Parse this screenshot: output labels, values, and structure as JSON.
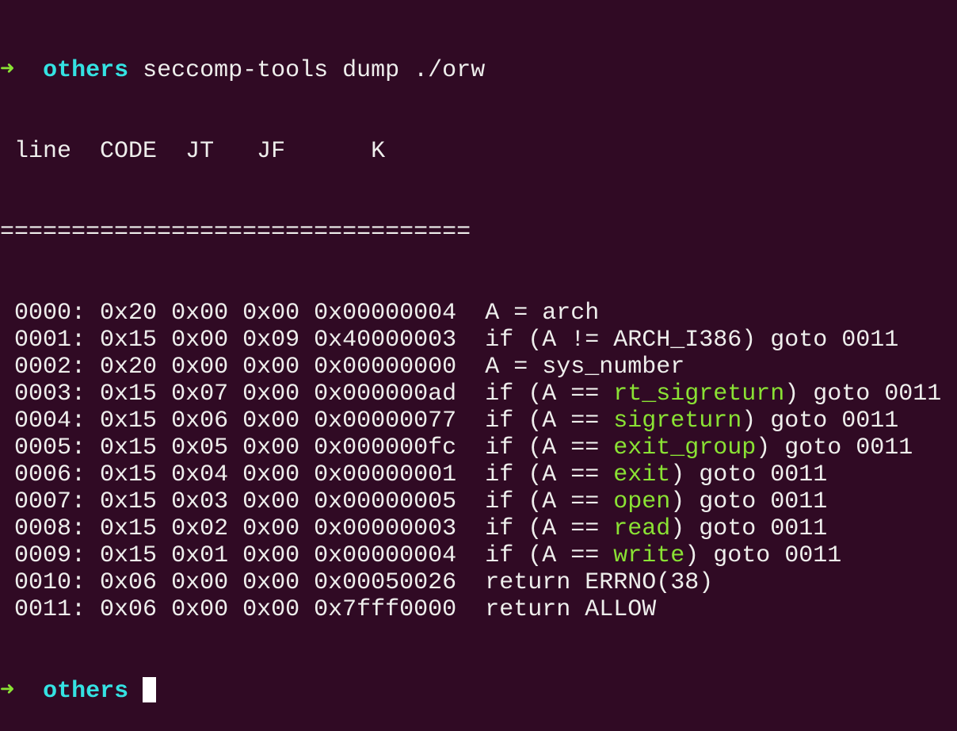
{
  "prompt": {
    "arrow": "➜",
    "dir": "others",
    "command": "seccomp-tools dump ./orw"
  },
  "header": {
    "line": "line",
    "code": "CODE",
    "jt": "JT",
    "jf": "JF",
    "k": "K"
  },
  "separator": "=================================",
  "rows": [
    {
      "line": "0000",
      "code": "0x20",
      "jt": "0x00",
      "jf": "0x00",
      "k": "0x00000004",
      "pre": "A = arch",
      "hl": "",
      "post": ""
    },
    {
      "line": "0001",
      "code": "0x15",
      "jt": "0x00",
      "jf": "0x09",
      "k": "0x40000003",
      "pre": "if (A != ARCH_I386) goto 0011",
      "hl": "",
      "post": ""
    },
    {
      "line": "0002",
      "code": "0x20",
      "jt": "0x00",
      "jf": "0x00",
      "k": "0x00000000",
      "pre": "A = sys_number",
      "hl": "",
      "post": ""
    },
    {
      "line": "0003",
      "code": "0x15",
      "jt": "0x07",
      "jf": "0x00",
      "k": "0x000000ad",
      "pre": "if (A == ",
      "hl": "rt_sigreturn",
      "post": ") goto 0011"
    },
    {
      "line": "0004",
      "code": "0x15",
      "jt": "0x06",
      "jf": "0x00",
      "k": "0x00000077",
      "pre": "if (A == ",
      "hl": "sigreturn",
      "post": ") goto 0011"
    },
    {
      "line": "0005",
      "code": "0x15",
      "jt": "0x05",
      "jf": "0x00",
      "k": "0x000000fc",
      "pre": "if (A == ",
      "hl": "exit_group",
      "post": ") goto 0011"
    },
    {
      "line": "0006",
      "code": "0x15",
      "jt": "0x04",
      "jf": "0x00",
      "k": "0x00000001",
      "pre": "if (A == ",
      "hl": "exit",
      "post": ") goto 0011"
    },
    {
      "line": "0007",
      "code": "0x15",
      "jt": "0x03",
      "jf": "0x00",
      "k": "0x00000005",
      "pre": "if (A == ",
      "hl": "open",
      "post": ") goto 0011"
    },
    {
      "line": "0008",
      "code": "0x15",
      "jt": "0x02",
      "jf": "0x00",
      "k": "0x00000003",
      "pre": "if (A == ",
      "hl": "read",
      "post": ") goto 0011"
    },
    {
      "line": "0009",
      "code": "0x15",
      "jt": "0x01",
      "jf": "0x00",
      "k": "0x00000004",
      "pre": "if (A == ",
      "hl": "write",
      "post": ") goto 0011"
    },
    {
      "line": "0010",
      "code": "0x06",
      "jt": "0x00",
      "jf": "0x00",
      "k": "0x00050026",
      "pre": "return ERRNO(38)",
      "hl": "",
      "post": ""
    },
    {
      "line": "0011",
      "code": "0x06",
      "jt": "0x00",
      "jf": "0x00",
      "k": "0x7fff0000",
      "pre": "return ALLOW",
      "hl": "",
      "post": ""
    }
  ],
  "final_prompt": {
    "arrow": "➜",
    "dir": "others"
  },
  "colors": {
    "background": "#300a24",
    "text": "#eeeeec",
    "arrow": "#8ae234",
    "dir": "#34e2e2",
    "syscall": "#8ae234"
  }
}
